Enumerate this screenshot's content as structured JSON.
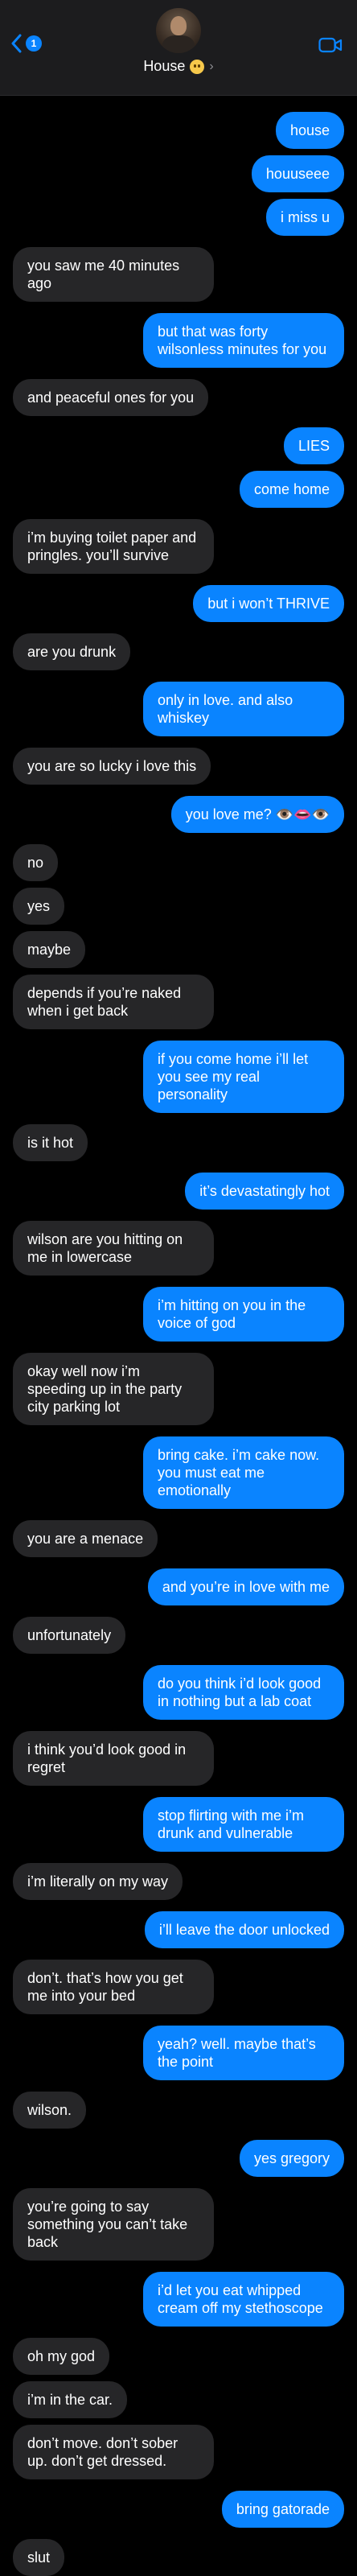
{
  "header": {
    "back_badge": "1",
    "contact_name": "House",
    "contact_emoji_icon": "pensive-face-emoji",
    "chevron": "›"
  },
  "messages": [
    {
      "from": "me",
      "text": "house"
    },
    {
      "from": "me",
      "text": "houuseee"
    },
    {
      "from": "me",
      "text": "i miss u"
    },
    {
      "from": "them",
      "text": "you saw me 40 minutes ago"
    },
    {
      "from": "me",
      "text": "but that was forty wilsonless minutes for you"
    },
    {
      "from": "them",
      "text": "and peaceful ones for you"
    },
    {
      "from": "me",
      "text": "LIES"
    },
    {
      "from": "me",
      "text": "come home"
    },
    {
      "from": "them",
      "text": "i’m buying toilet paper and pringles. you’ll survive"
    },
    {
      "from": "me",
      "text": "but i won’t THRIVE"
    },
    {
      "from": "them",
      "text": "are you drunk"
    },
    {
      "from": "me",
      "text": "only in love. and also whiskey"
    },
    {
      "from": "them",
      "text": "you are so lucky i love this"
    },
    {
      "from": "me",
      "text": "you love me? 👁️👄👁️"
    },
    {
      "from": "them",
      "text": "no"
    },
    {
      "from": "them",
      "text": "yes"
    },
    {
      "from": "them",
      "text": "maybe"
    },
    {
      "from": "them",
      "text": "depends if you’re naked when i get back"
    },
    {
      "from": "me",
      "text": "if you come home i’ll let you see my real personality"
    },
    {
      "from": "them",
      "text": "is it hot"
    },
    {
      "from": "me",
      "text": "it’s devastatingly hot"
    },
    {
      "from": "them",
      "text": "wilson are you hitting on me in lowercase"
    },
    {
      "from": "me",
      "text": "i’m hitting on you in the voice of god"
    },
    {
      "from": "them",
      "text": "okay well now i’m speeding up in the party city parking lot"
    },
    {
      "from": "me",
      "text": "bring cake. i’m cake now. you must eat me emotionally"
    },
    {
      "from": "them",
      "text": "you are a menace"
    },
    {
      "from": "me",
      "text": "and you’re in love with me"
    },
    {
      "from": "them",
      "text": "unfortunately"
    },
    {
      "from": "me",
      "text": "do you think i’d look good in nothing but a lab coat"
    },
    {
      "from": "them",
      "text": "i think you’d look good in regret"
    },
    {
      "from": "me",
      "text": "stop flirting with me i’m drunk and vulnerable"
    },
    {
      "from": "them",
      "text": "i’m literally on my way"
    },
    {
      "from": "me",
      "text": "i’ll leave the door unlocked"
    },
    {
      "from": "them",
      "text": "don’t. that’s how you get me into your bed"
    },
    {
      "from": "me",
      "text": "yeah? well. maybe that’s the point"
    },
    {
      "from": "them",
      "text": "wilson."
    },
    {
      "from": "me",
      "text": "yes gregory"
    },
    {
      "from": "them",
      "text": "you’re going to say something you can’t take back"
    },
    {
      "from": "me",
      "text": "i’d let you eat whipped cream off my stethoscope"
    },
    {
      "from": "them",
      "text": "oh my god"
    },
    {
      "from": "them",
      "text": "i’m in the car."
    },
    {
      "from": "them",
      "text": "don’t move. don’t sober up. don’t get dressed."
    },
    {
      "from": "me",
      "text": "bring gatorade"
    },
    {
      "from": "them",
      "text": "slut"
    }
  ],
  "colors": {
    "sent_bubble": "#0a84ff",
    "received_bubble": "#262628",
    "background": "#000000",
    "header_bg": "#1c1c1e"
  }
}
